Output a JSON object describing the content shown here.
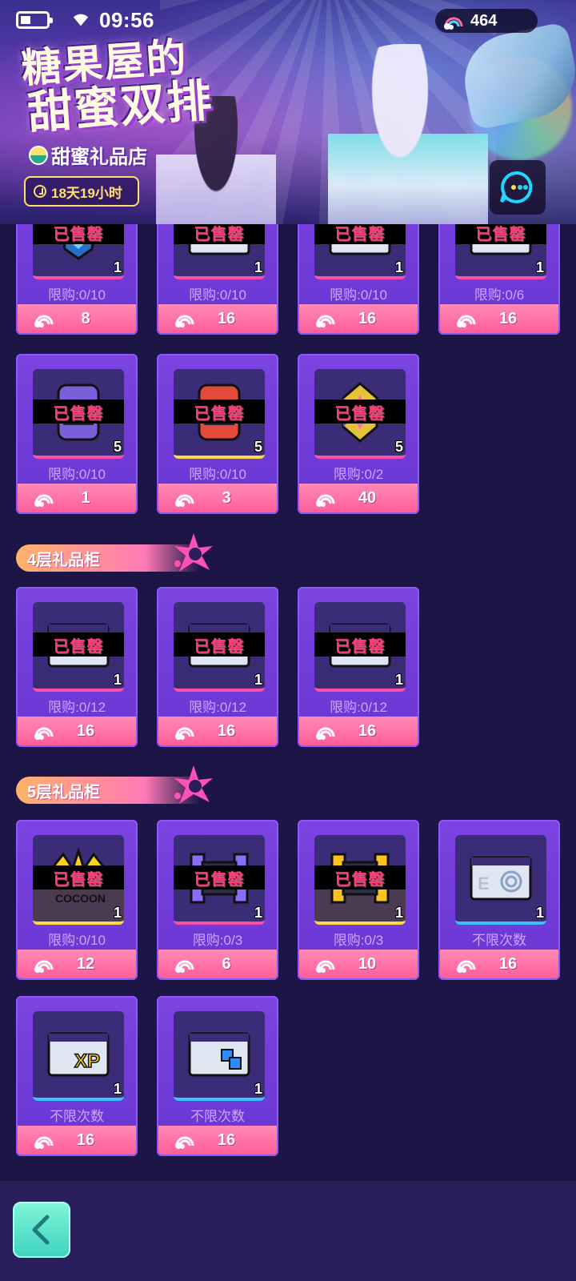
{
  "status_bar": {
    "time": "09:56"
  },
  "currency": {
    "amount": "464",
    "icon": "rainbow-icon"
  },
  "banner": {
    "title_line1": "糖果屋的",
    "title_line2": "甜蜜双排",
    "shop_name": "甜蜜礼品店",
    "countdown": "18天19小时"
  },
  "sold_label": "已售罄",
  "rows": [
    {
      "items": [
        {
          "qty": "1",
          "limit": "限购:0/10",
          "price": "8",
          "sold": true,
          "art": "shield",
          "accent": "pink"
        },
        {
          "qty": "1",
          "limit": "限购:0/10",
          "price": "16",
          "sold": true,
          "art": "card",
          "accent": "pink"
        },
        {
          "qty": "1",
          "limit": "限购:0/10",
          "price": "16",
          "sold": true,
          "art": "card",
          "accent": "pink"
        },
        {
          "qty": "1",
          "limit": "限购:0/6",
          "price": "16",
          "sold": true,
          "art": "card",
          "accent": "pink"
        }
      ]
    },
    {
      "items": [
        {
          "qty": "5",
          "limit": "限购:0/10",
          "price": "1",
          "sold": true,
          "art": "capsule-purple",
          "accent": "pink"
        },
        {
          "qty": "5",
          "limit": "限购:0/10",
          "price": "3",
          "sold": true,
          "art": "capsule-red",
          "accent": "yellow"
        },
        {
          "qty": "5",
          "limit": "限购:0/2",
          "price": "40",
          "sold": true,
          "art": "gem",
          "accent": "pink"
        }
      ]
    }
  ],
  "sections": [
    {
      "title": "4层礼品柜",
      "items": [
        {
          "qty": "1",
          "limit": "限购:0/12",
          "price": "16",
          "sold": true,
          "art": "card",
          "accent": "pink"
        },
        {
          "qty": "1",
          "limit": "限购:0/12",
          "price": "16",
          "sold": true,
          "art": "card",
          "accent": "pink"
        },
        {
          "qty": "1",
          "limit": "限购:0/12",
          "price": "16",
          "sold": true,
          "art": "card",
          "accent": "pink"
        }
      ]
    },
    {
      "title": "5层礼品柜",
      "items": [
        {
          "qty": "1",
          "limit": "限购:0/10",
          "price": "12",
          "sold": true,
          "art": "crown",
          "accent": "yellow"
        },
        {
          "qty": "1",
          "limit": "限购:0/3",
          "price": "6",
          "sold": true,
          "art": "car-purple",
          "accent": "pink"
        },
        {
          "qty": "1",
          "limit": "限购:0/3",
          "price": "10",
          "sold": true,
          "art": "car-yellow",
          "accent": "yellow"
        },
        {
          "qty": "1",
          "limit": "不限次数",
          "price": "16",
          "sold": false,
          "art": "card-target",
          "accent": "blue"
        },
        {
          "qty": "1",
          "limit": "不限次数",
          "price": "16",
          "sold": false,
          "art": "card-xp",
          "accent": "blue"
        },
        {
          "qty": "1",
          "limit": "不限次数",
          "price": "16",
          "sold": false,
          "art": "card-swap",
          "accent": "blue"
        }
      ]
    }
  ],
  "colors": {
    "background": "#1c1546",
    "card": "#7b43e0",
    "price_bar": "#ff5d9a",
    "sold_text": "#ff3d7a",
    "back_button": "#3fd3c0"
  }
}
